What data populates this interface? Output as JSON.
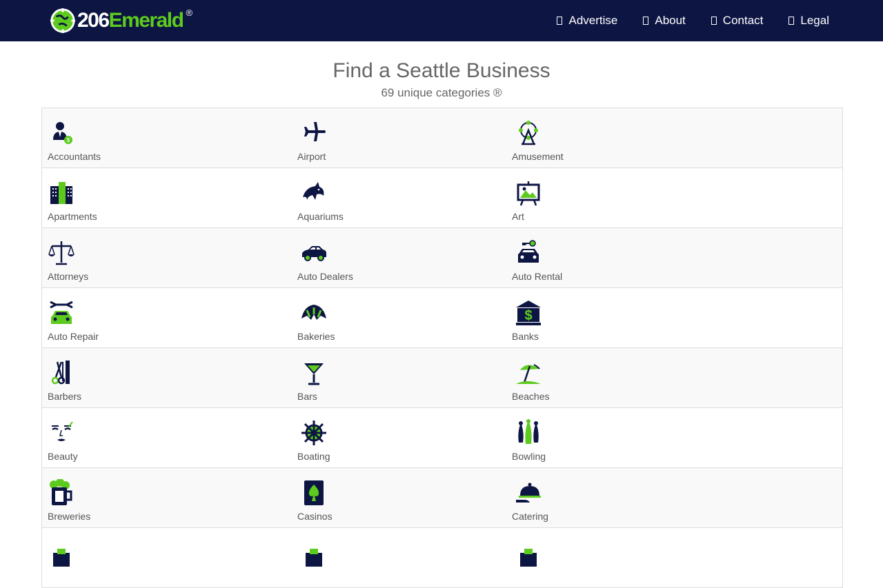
{
  "brand": {
    "number": "206",
    "word": "Emerald",
    "registered": "®"
  },
  "nav": [
    {
      "label": "Advertise"
    },
    {
      "label": "About"
    },
    {
      "label": "Contact"
    },
    {
      "label": "Legal"
    }
  ],
  "page": {
    "title": "Find a Seattle Business",
    "subtitle": "69 unique categories ®"
  },
  "colors": {
    "navy": "#0d1543",
    "green": "#5dcb1e",
    "text": "#555555"
  },
  "categories": [
    {
      "label": "Accountants",
      "icon": "accountant-icon"
    },
    {
      "label": "Airport",
      "icon": "airplane-icon"
    },
    {
      "label": "Amusement",
      "icon": "ferris-wheel-icon"
    },
    {
      "label": "Apartments",
      "icon": "apartment-building-icon"
    },
    {
      "label": "Aquariums",
      "icon": "dolphin-icon"
    },
    {
      "label": "Art",
      "icon": "easel-painting-icon"
    },
    {
      "label": "Attorneys",
      "icon": "scales-of-justice-icon"
    },
    {
      "label": "Auto Dealers",
      "icon": "car-icon"
    },
    {
      "label": "Auto Rental",
      "icon": "car-key-icon"
    },
    {
      "label": "Auto Repair",
      "icon": "wrench-car-icon"
    },
    {
      "label": "Bakeries",
      "icon": "croissant-icon"
    },
    {
      "label": "Banks",
      "icon": "bank-dollar-icon"
    },
    {
      "label": "Barbers",
      "icon": "scissors-comb-icon"
    },
    {
      "label": "Bars",
      "icon": "martini-glass-icon"
    },
    {
      "label": "Beaches",
      "icon": "beach-umbrella-icon"
    },
    {
      "label": "Beauty",
      "icon": "face-makeup-icon"
    },
    {
      "label": "Boating",
      "icon": "ship-wheel-icon"
    },
    {
      "label": "Bowling",
      "icon": "bowling-pins-icon"
    },
    {
      "label": "Breweries",
      "icon": "beer-mug-icon"
    },
    {
      "label": "Casinos",
      "icon": "spade-card-icon"
    },
    {
      "label": "Catering",
      "icon": "cloche-platter-icon"
    },
    {
      "label": "",
      "icon": "category-icon"
    },
    {
      "label": "",
      "icon": "category-icon"
    },
    {
      "label": "",
      "icon": "category-icon"
    }
  ]
}
